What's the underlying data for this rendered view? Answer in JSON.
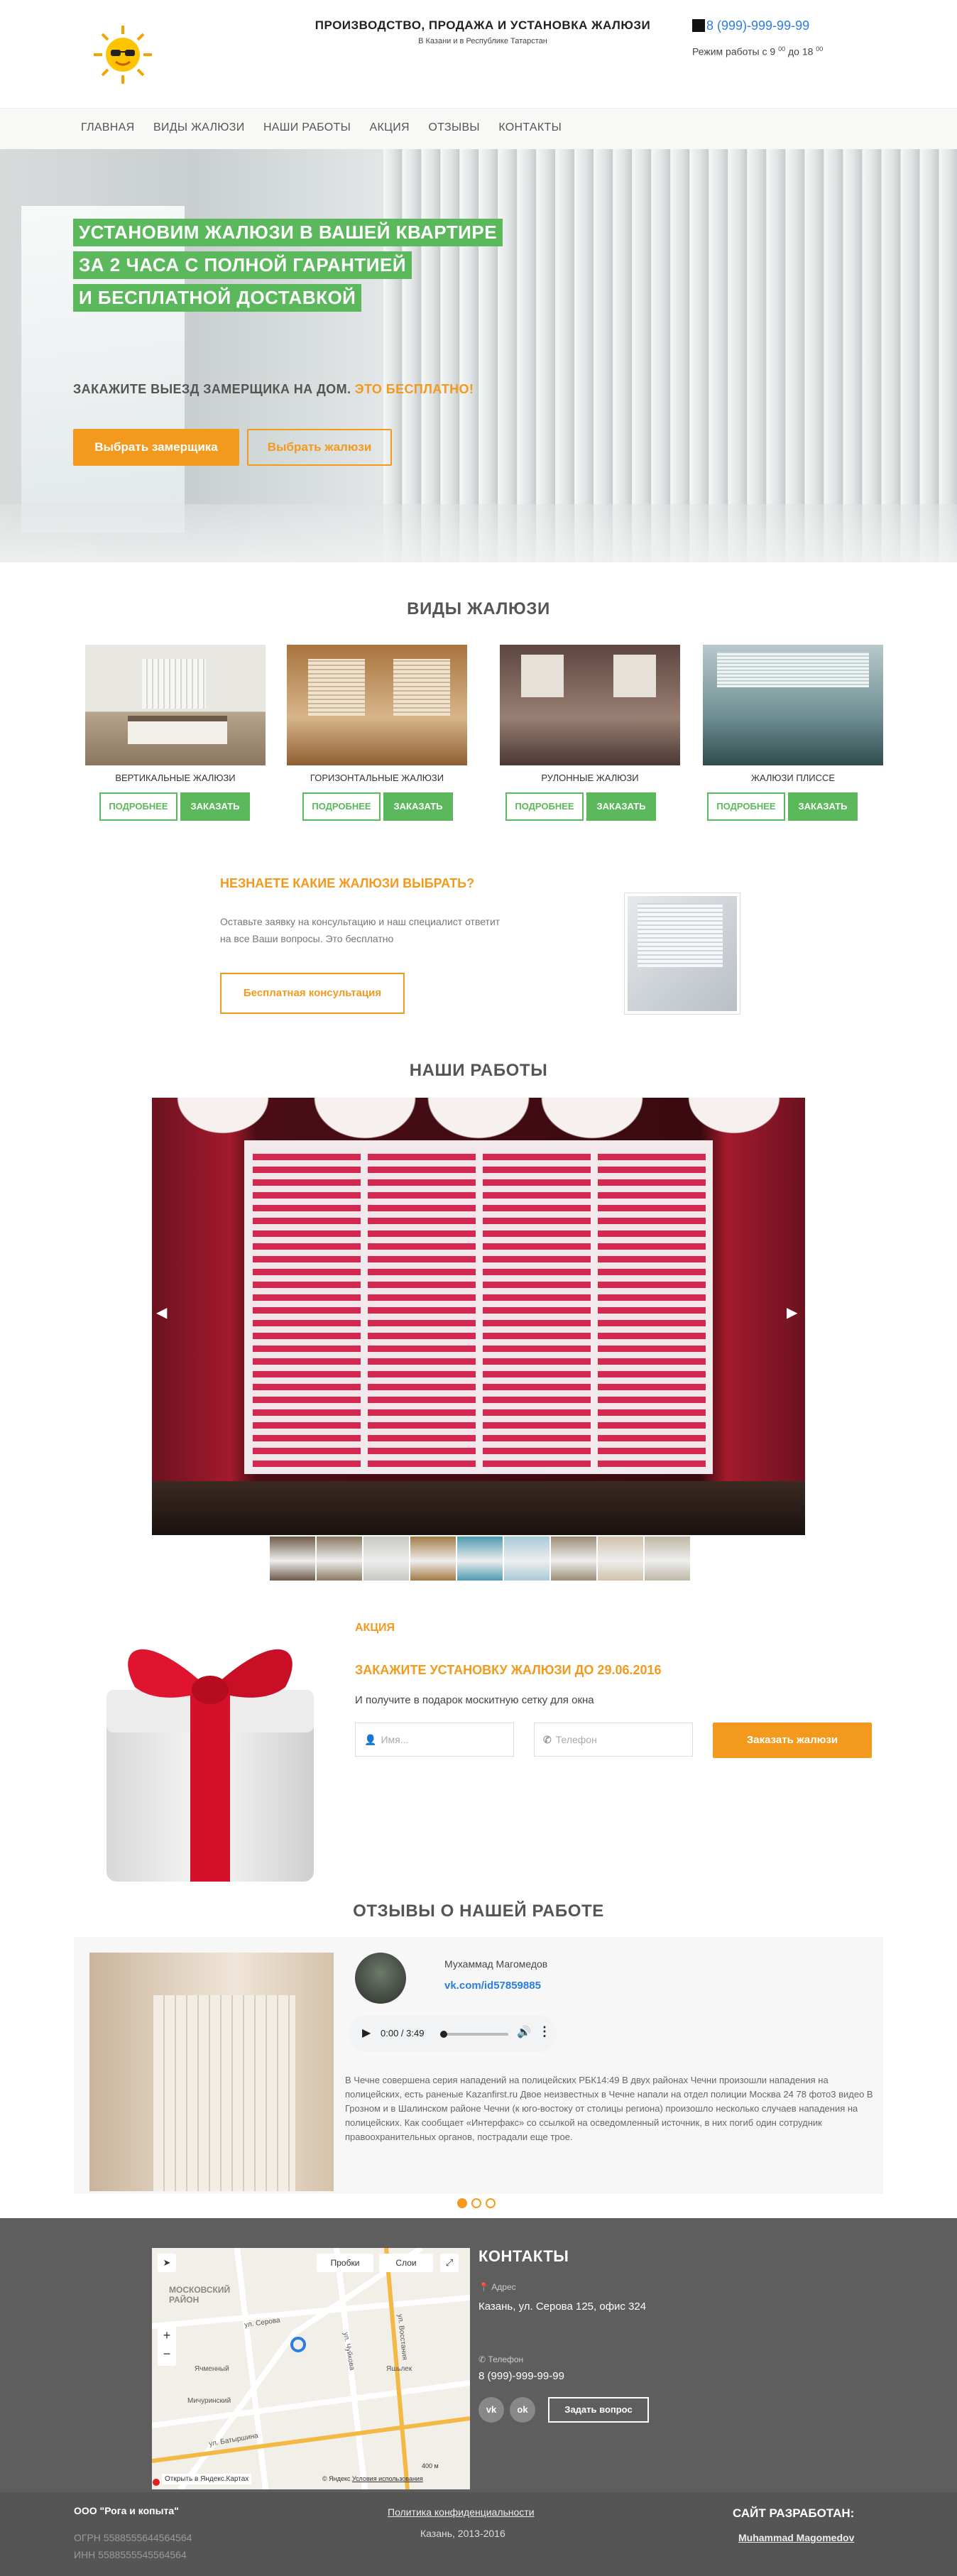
{
  "header": {
    "title": "ПРОИЗВОДСТВО, ПРОДАЖА И УСТАНОВКА ЖАЛЮЗИ",
    "subtitle": "В Казани и в Республике Татарстан",
    "phone": "8 (999)-999-99-99",
    "hours_prefix": "Режим работы с 9",
    "hours_sup1": "00",
    "hours_mid": "до 18",
    "hours_sup2": "00",
    "logo_icon": "sun-with-sunglasses-icon"
  },
  "nav": [
    "ГЛАВНАЯ",
    "ВИДЫ ЖАЛЮЗИ",
    "НАШИ РАБОТЫ",
    "АКЦИЯ",
    "ОТЗЫВЫ",
    "КОНТАКТЫ"
  ],
  "hero": {
    "line1": "УСТАНОВИМ ЖАЛЮЗИ В ВАШЕЙ КВАРТИРЕ",
    "line2": "ЗА 2 ЧАСА С ПОЛНОЙ ГАРАНТИЕЙ",
    "line3": "И БЕСПЛАТНОЙ ДОСТАВКОЙ",
    "cta_text": "ЗАКАЖИТЕ ВЫЕЗД ЗАМЕРЩИКА НА ДОМ.",
    "cta_accent": "ЭТО БЕСПЛАТНО!",
    "btn_primary": "Выбрать замерщика",
    "btn_secondary": "Выбрать жалюзи"
  },
  "types": {
    "title": "ВИДЫ ЖАЛЮЗИ",
    "items": [
      {
        "label": "ВЕРТИКАЛЬНЫЕ ЖАЛЮЗИ",
        "more": "ПОДРОБНЕЕ",
        "order": "ЗАКАЗАТЬ"
      },
      {
        "label": "ГОРИЗОНТАЛЬНЫЕ ЖАЛЮЗИ",
        "more": "ПОДРОБНЕЕ",
        "order": "ЗАКАЗАТЬ"
      },
      {
        "label": "РУЛОННЫЕ ЖАЛЮЗИ",
        "more": "ПОДРОБНЕЕ",
        "order": "ЗАКАЗАТЬ"
      },
      {
        "label": "ЖАЛЮЗИ ПЛИССЕ",
        "more": "ПОДРОБНЕЕ",
        "order": "ЗАКАЗАТЬ"
      }
    ]
  },
  "consult": {
    "title": "НЕЗНАЕТЕ КАКИЕ ЖАЛЮЗИ ВЫБРАТЬ?",
    "text1": "Оставьте заявку на консультацию и наш специалист ответит",
    "text2": "на все Ваши вопросы. Это бесплатно",
    "button": "Бесплатная консультация"
  },
  "works": {
    "title": "НАШИ РАБОТЫ",
    "prev": "◀",
    "next": "▶"
  },
  "promo": {
    "label": "АКЦИЯ",
    "title": "ЗАКАЖИТЕ УСТАНОВКУ ЖАЛЮЗИ ДО 29.06.2016",
    "text": "И получите в подарок москитную сетку для окна",
    "name_placeholder": "Имя...",
    "phone_placeholder": "Телефон",
    "button": "Заказать жалюзи"
  },
  "reviews": {
    "title": "ОТЗЫВЫ О НАШЕЙ РАБОТЕ",
    "name": "Мухаммад Магомедов",
    "link": "vk.com/id57859885",
    "audio_time": "0:00 / 3:49",
    "text": "В Чечне совершена серия нападений на полицейских РБК14:49 В двух районах Чечни произошли нападения на полицейских, есть раненые Kazanfirst.ru Двое неизвестных в Чечне напали на отдел полиции Москва 24 78 фото3 видео В Грозном и в Шалинском районе Чечни (к юго-востоку от столицы региона) произошло несколько случаев нападения на полицейских. Как сообщает «Интерфакс» со ссылкой на осведомленный источник, в них погиб один сотрудник правоохранительных органов, пострадали еще трое."
  },
  "contacts": {
    "title": "КОНТАКТЫ",
    "addr_label": "Адрес",
    "addr": "Казань, ул. Серова 125, офис 324",
    "tel_label": "Телефон",
    "tel": "8 (999)-999-99-99",
    "vk": "vk",
    "ok": "ok",
    "ask": "Задать вопрос",
    "map": {
      "traffic": "Пробки",
      "layers": "Слои",
      "district": "МОСКОВСКИЙ РАЙОН",
      "street1": "ул. Серова",
      "street2": "ул. Чуйкова",
      "street3": "ул. Батыршина",
      "street4": "ул. Восстания",
      "place1": "Ячменный",
      "place2": "Яшьлек",
      "place3": "Мичуринский",
      "open": "Открыть в Яндекс.Картах",
      "copyright": "© Яндекс",
      "terms": "Условия использования",
      "scale": "400 м"
    }
  },
  "footer": {
    "company": "ООО \"Рога и копыта\"",
    "ogrn": "ОГРН 5588555644564564",
    "inn": "ИНН 5588555545564564",
    "policy": "Политика конфиденциальности",
    "city_years": "Казань, 2013-2016",
    "dev_label": "САЙТ РАЗРАБОТАН:",
    "dev_name": "Muhammad Magomedov"
  }
}
